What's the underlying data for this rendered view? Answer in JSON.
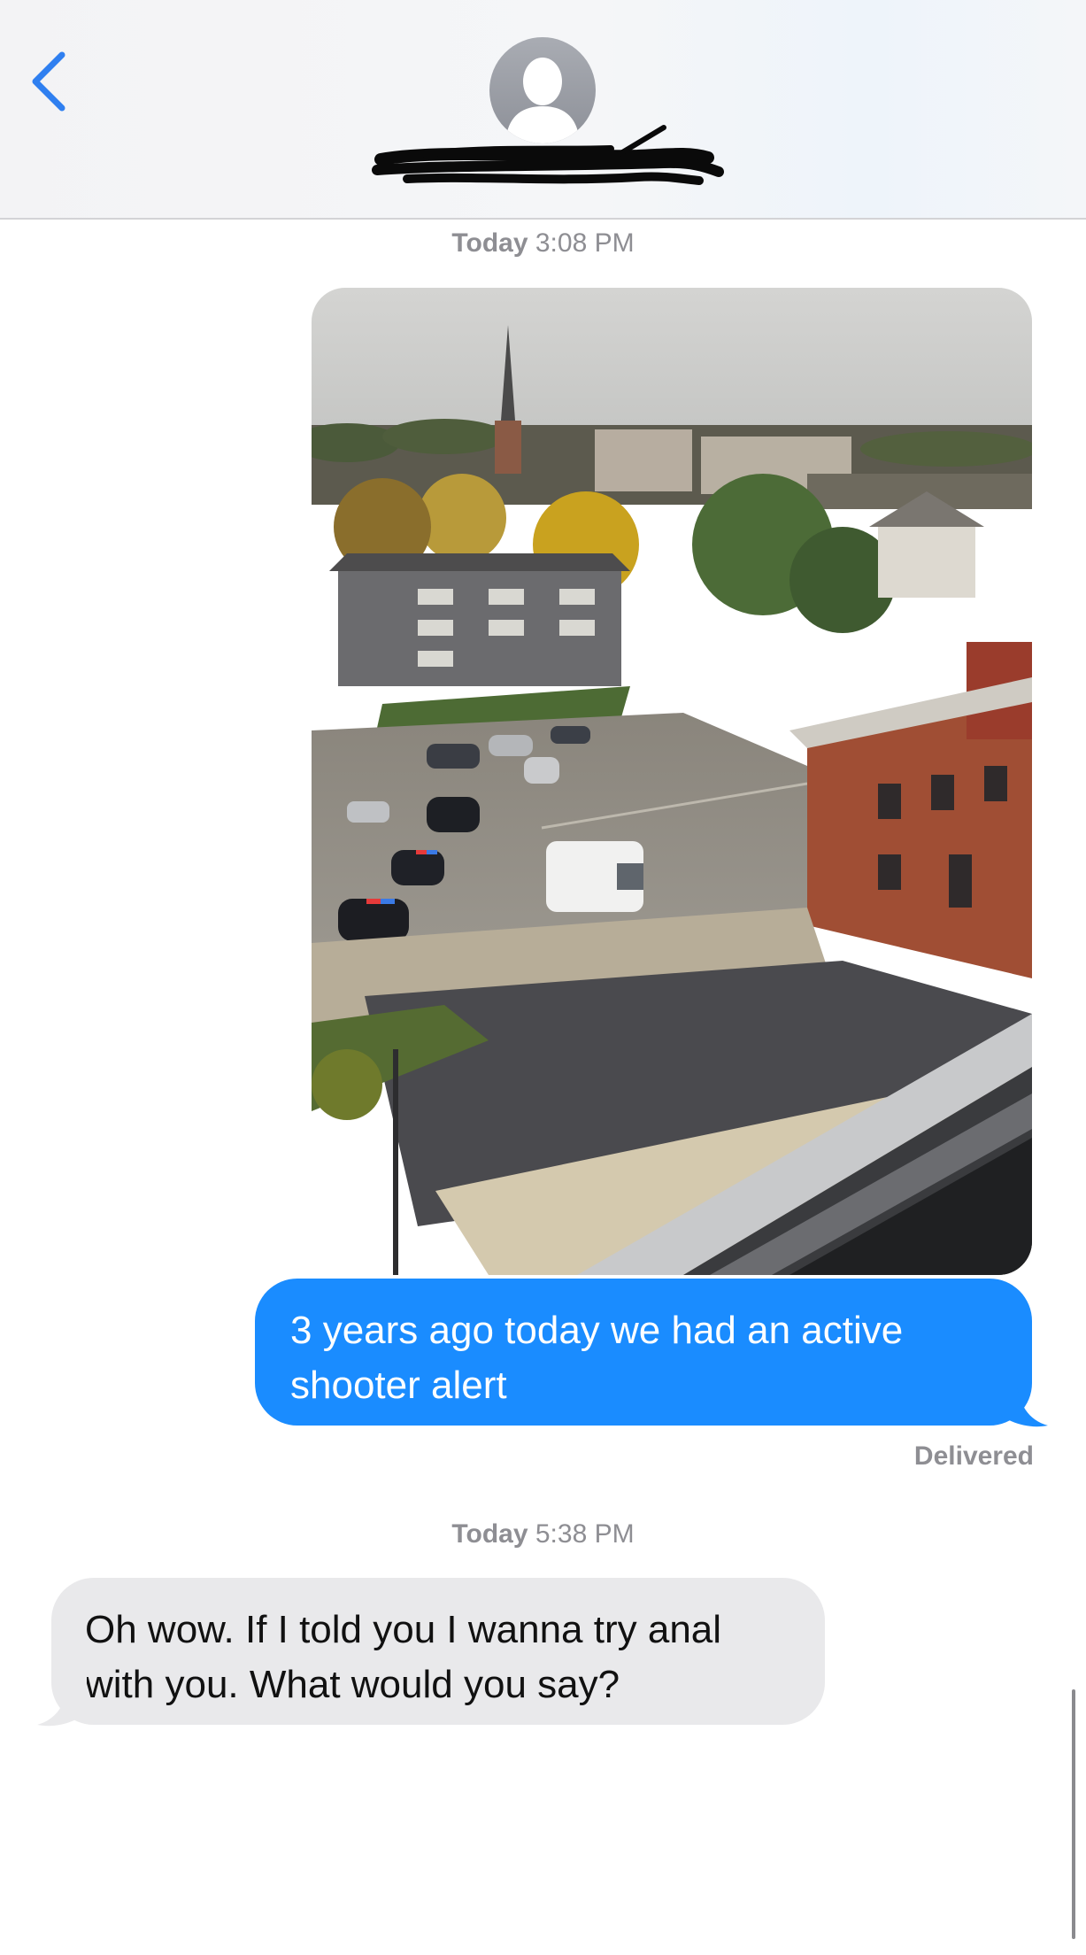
{
  "header": {
    "back_icon": "chevron-left-icon",
    "avatar_icon": "person-silhouette-icon",
    "contact_name": "[redacted]"
  },
  "conversation": {
    "timestamp_1": {
      "day": "Today",
      "time": "3:08 PM"
    },
    "photo_description_icon": "photo-attachment",
    "sent_message": "3 years ago today we had an active shooter alert",
    "delivery_status": "Delivered",
    "timestamp_2": {
      "day": "Today",
      "time": "5:38 PM"
    },
    "received_message": "Oh wow. If I told you I wanna try anal with you. What would you say?"
  },
  "colors": {
    "accent_blue": "#1a8cff",
    "back_chevron": "#2f7ff0",
    "received_bubble": "#e9e9eb",
    "timestamp_gray": "#8e8e93"
  }
}
